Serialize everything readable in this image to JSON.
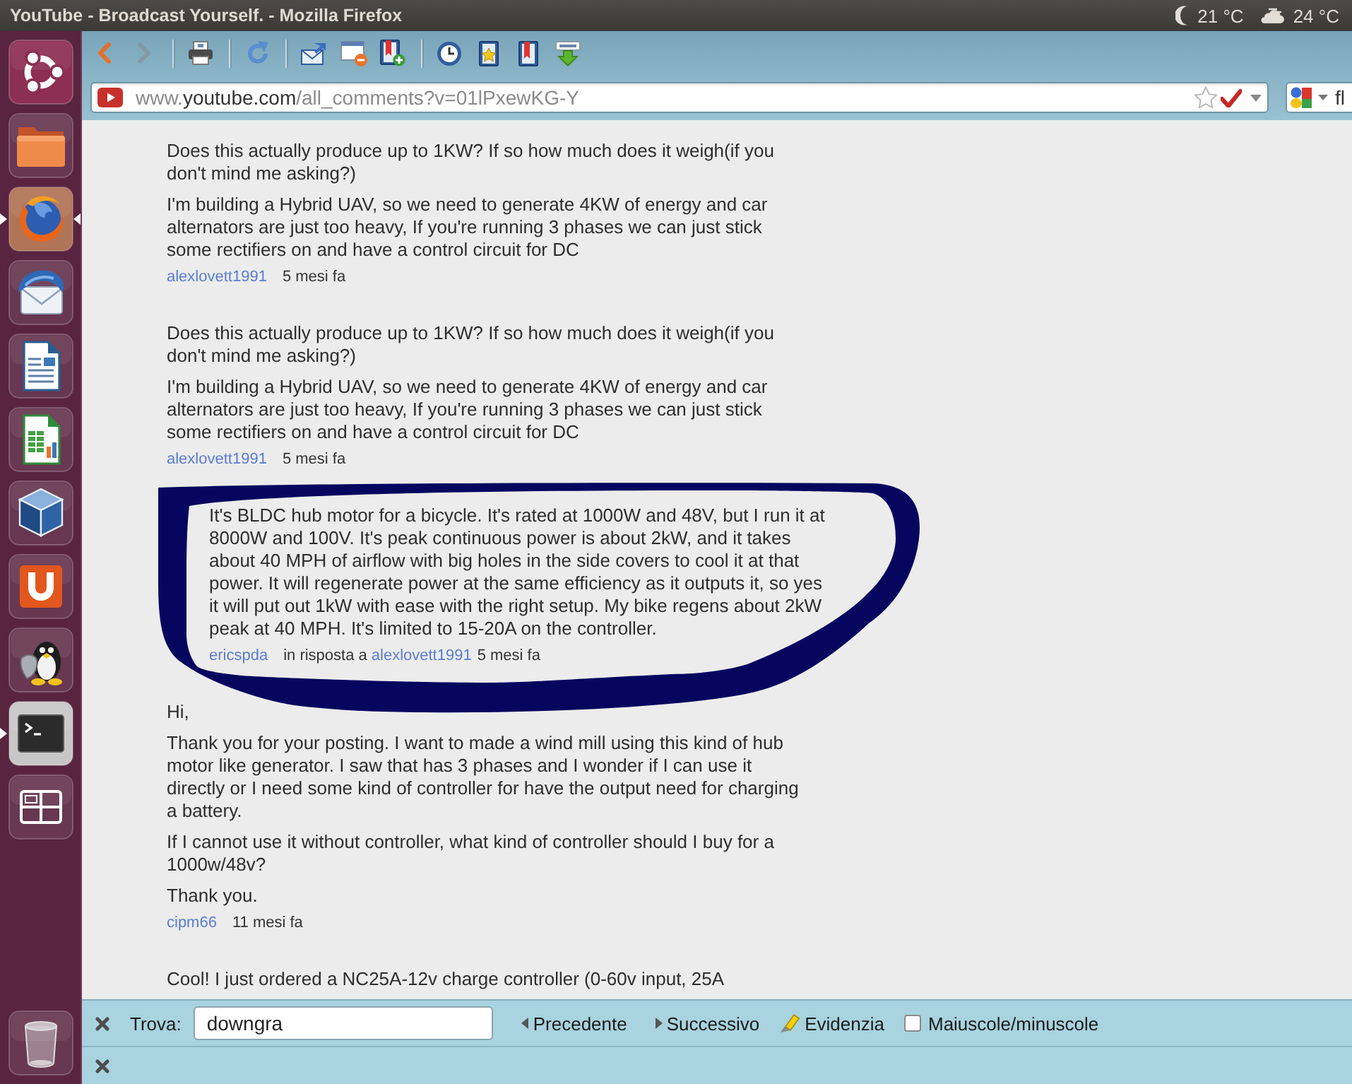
{
  "top_panel": {
    "title": "YouTube - Broadcast Yourself. - Mozilla Firefox",
    "weather": [
      {
        "kind": "night",
        "temperature": "21 °C"
      },
      {
        "kind": "cloudy",
        "temperature": "24 °C"
      }
    ]
  },
  "launcher": {
    "items": [
      {
        "kind": "dash",
        "running": false,
        "focused": false
      },
      {
        "kind": "folder",
        "running": false,
        "focused": false
      },
      {
        "kind": "browser",
        "running": true,
        "focused": true
      },
      {
        "kind": "mail",
        "running": false,
        "focused": false
      },
      {
        "kind": "document",
        "running": false,
        "focused": false
      },
      {
        "kind": "spreadsheet",
        "running": false,
        "focused": false
      },
      {
        "kind": "cube",
        "running": false,
        "focused": false
      },
      {
        "kind": "u-tile",
        "running": false,
        "focused": false
      },
      {
        "kind": "penguin",
        "running": false,
        "focused": false
      },
      {
        "kind": "terminal",
        "running": true,
        "focused": false
      },
      {
        "kind": "workspaces",
        "running": false,
        "focused": false
      },
      {
        "kind": "trash",
        "running": false,
        "focused": false
      }
    ]
  },
  "toolbar": {
    "groups": [
      [
        {
          "kind": "back",
          "disabled": false
        },
        {
          "kind": "forward",
          "disabled": true
        }
      ],
      [
        {
          "kind": "print",
          "disabled": false
        }
      ],
      [
        {
          "kind": "reload",
          "disabled": false
        }
      ],
      [
        {
          "kind": "send-link",
          "disabled": false
        },
        {
          "kind": "window",
          "disabled": false
        },
        {
          "kind": "bookmark-add",
          "disabled": false
        }
      ],
      [
        {
          "kind": "history",
          "disabled": false
        },
        {
          "kind": "bookmarks",
          "disabled": false
        },
        {
          "kind": "bookmark",
          "disabled": false
        },
        {
          "kind": "downloads",
          "disabled": false
        }
      ]
    ]
  },
  "address_bar": {
    "url": {
      "before": "www.",
      "domain": "youtube.com",
      "after": "/all_comments?v=01lPxewKG-Y"
    },
    "bookmarked": false
  },
  "search_bar": {
    "value": "fl"
  },
  "comments": [
    {
      "kind": "comment",
      "annotated": false,
      "paragraphs": [
        "Does this actually produce up to 1KW? If so how much does it weigh(if you don't mind me asking?)",
        "I'm building a Hybrid UAV, so we need to generate 4KW of energy and car alternators are just too heavy, If you're running 3 phases we can just stick some rectifiers on and have a control circuit for DC"
      ],
      "author": "alexlovett1991",
      "time": "5 mesi fa"
    },
    {
      "kind": "comment",
      "annotated": false,
      "paragraphs": [
        "Does this actually produce up to 1KW? If so how much does it weigh(if you don't mind me asking?)",
        "I'm building a Hybrid UAV, so we need to generate 4KW of energy and car alternators are just too heavy, If you're running 3 phases we can just stick some rectifiers on and have a control circuit for DC"
      ],
      "author": "alexlovett1991",
      "time": "5 mesi fa"
    },
    {
      "kind": "reply",
      "annotated": true,
      "paragraphs": [
        "It's BLDC hub motor for a bicycle. It's rated at 1000W and 48V, but I run it at 8000W and 100V. It's peak continuous power is about 2kW, and it takes about 40 MPH of airflow with big holes in the side covers to cool it at that power. It will regenerate power at the same efficiency as it outputs it, so yes it will put out 1kW with ease with the right setup. My bike regens about 2kW peak at 40 MPH. It's limited to 15-20A on the controller."
      ],
      "author": "ericspda",
      "reply_label": "in risposta a",
      "reply_to": "alexlovett1991",
      "time": "5 mesi fa"
    },
    {
      "kind": "comment",
      "annotated": false,
      "paragraphs": [
        "Hi,",
        "Thank you for your posting. I want to made a wind mill using this kind of hub motor like generator. I saw that has 3 phases and I wonder if I can use it directly or I need some kind of controller for have the output need for charging a battery.",
        "If I cannot use it without controller, what kind of controller should I buy for a 1000w/48v?",
        "Thank you."
      ],
      "author": "cipm66",
      "time": "11 mesi fa"
    },
    {
      "kind": "comment",
      "annotated": false,
      "paragraphs": [
        "Cool! I just ordered a NC25A-12v charge controller (0-60v input, 25A"
      ]
    }
  ],
  "find_bar": {
    "label": "Trova:",
    "value": "downgra",
    "buttons": [
      {
        "kind": "previous",
        "label": "Precedente"
      },
      {
        "kind": "next",
        "label": "Successivo"
      },
      {
        "kind": "highlight",
        "label": "Evidenzia"
      }
    ],
    "match_case": {
      "label": "Maiuscole/minuscole",
      "checked": false
    }
  }
}
